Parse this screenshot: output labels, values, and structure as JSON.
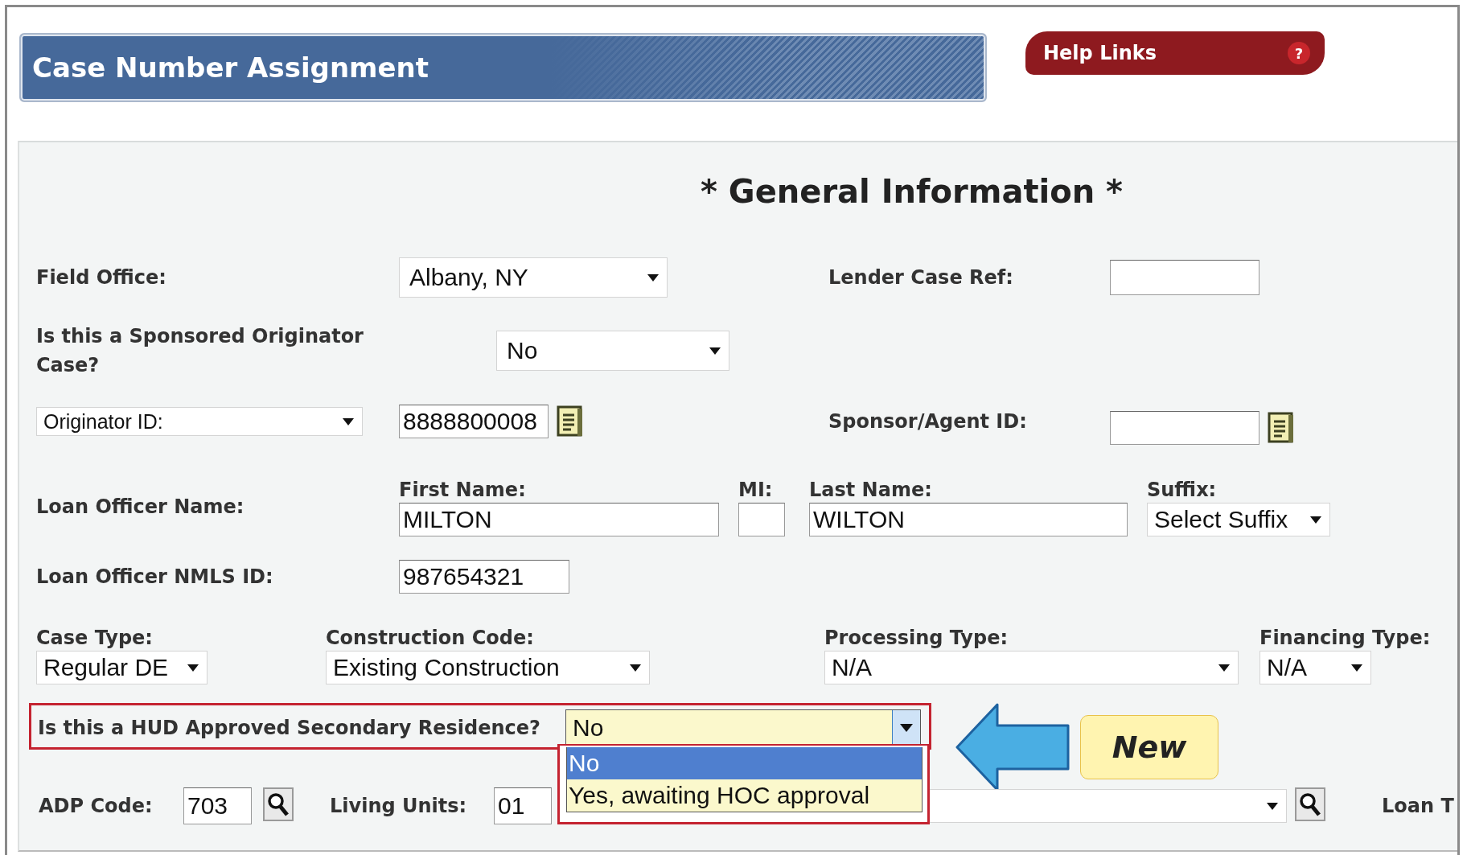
{
  "header": {
    "title": "Case Number Assignment",
    "help_link": "Help Links",
    "help_icon": "?"
  },
  "section_title": "* General Information *",
  "field_office": {
    "label": "Field Office:",
    "value": "Albany, NY"
  },
  "lender_case_ref": {
    "label": "Lender Case Ref:"
  },
  "sponsored": {
    "label": "Is this a Sponsored Originator Case?",
    "value": "No"
  },
  "originator_id": {
    "selector": "Originator ID:",
    "value": "8888800008"
  },
  "sponsor_agent_id": {
    "label": "Sponsor/Agent ID:"
  },
  "loan_officer": {
    "label": "Loan Officer Name:",
    "first_name": {
      "label": "First Name:",
      "value": "MILTON"
    },
    "mi": {
      "label": "MI:"
    },
    "last_name": {
      "label": "Last Name:",
      "value": "WILTON"
    },
    "suffix": {
      "label": "Suffix:",
      "value": "Select Suffix"
    }
  },
  "nmls": {
    "label": "Loan Officer NMLS ID:",
    "value": "987654321"
  },
  "types": [
    {
      "label": "Case Type:",
      "value": "Regular DE"
    },
    {
      "label": "Construction Code:",
      "value": "Existing Construction"
    },
    {
      "label": "Processing Type:",
      "value": "N/A"
    },
    {
      "label": "Financing Type:",
      "value": "N/A"
    }
  ],
  "secondary_residence": {
    "label": "Is this a HUD Approved Secondary Residence?",
    "value": "No",
    "expanded": true,
    "options": [
      {
        "label": "No",
        "selected": true
      },
      {
        "label": "Yes, awaiting HOC approval",
        "selected": false
      }
    ]
  },
  "adp_code": {
    "label": "ADP Code:",
    "value": "703"
  },
  "living_units": {
    "label": "Living Units:",
    "value": "01"
  },
  "cut_label": "Loan T",
  "callout": {
    "label": "New"
  }
}
